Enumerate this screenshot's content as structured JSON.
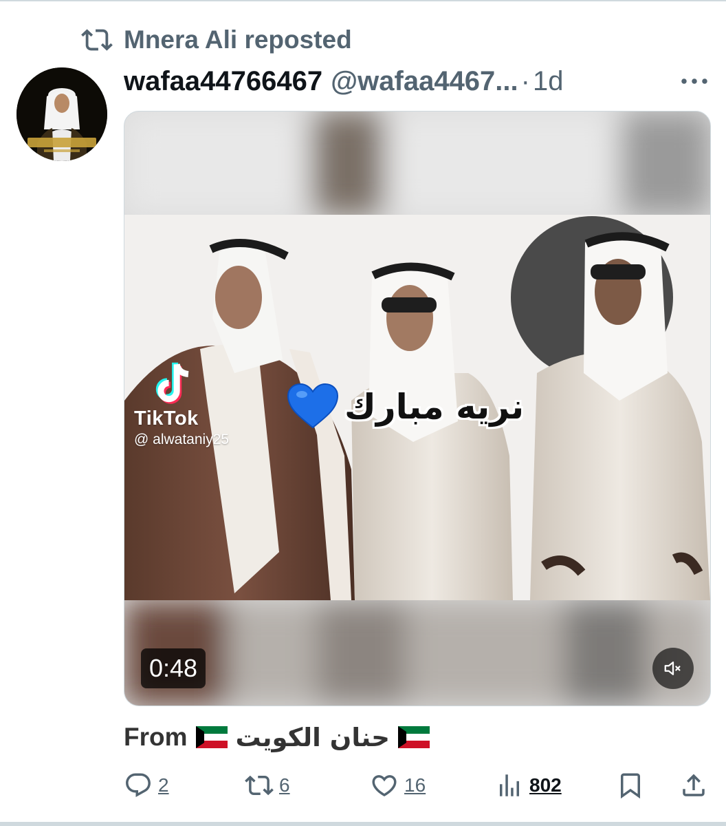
{
  "repost": {
    "label": "Mnera Ali reposted",
    "icon": "repost-icon"
  },
  "author": {
    "name": "wafaa44766467",
    "handle": "@wafaa4467...",
    "separator": "·",
    "time": "1d",
    "avatar": "avatar-icon"
  },
  "more_label": "···",
  "media": {
    "type": "video",
    "overlay_caption": "نريه مبارك",
    "heart": "💙",
    "watermark": {
      "brand": "TikTok",
      "user": "@ alwataniy25"
    },
    "duration": "0:48",
    "muted": true
  },
  "tweet": {
    "prefix": "From",
    "arabic": "حنان الكويت",
    "flag": "kuwait-flag-icon"
  },
  "actions": {
    "replies": "2",
    "reposts": "6",
    "likes": "16",
    "views": "802"
  },
  "colors": {
    "secondary_text": "#536471",
    "primary_text": "#0f1419",
    "kuwait_green": "#007a3d",
    "kuwait_red": "#ce1126"
  }
}
